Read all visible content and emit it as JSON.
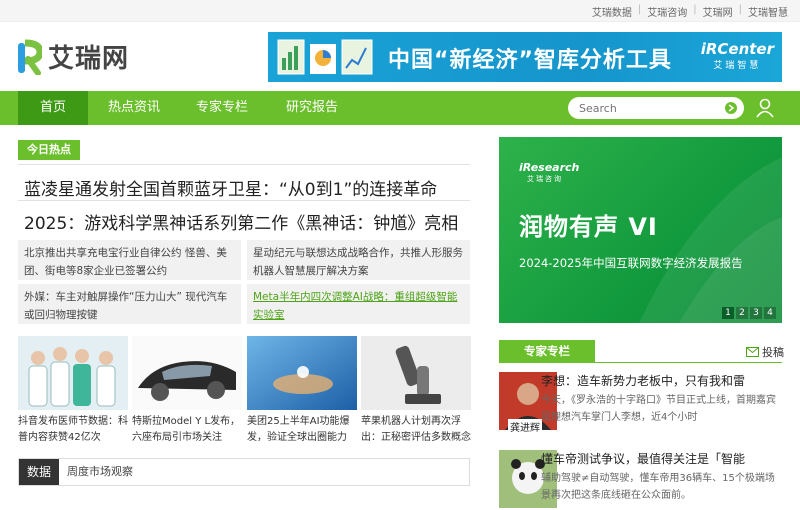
{
  "topbar": {
    "links": [
      "艾瑞数据",
      "艾瑞咨询",
      "艾瑞网",
      "艾瑞智慧"
    ]
  },
  "logo": {
    "text": "艾瑞网"
  },
  "banner": {
    "title": "中国“新经济”智库分析工具",
    "brand_main": "iRCenter",
    "brand_sub": "艾瑞智慧"
  },
  "nav": {
    "items": [
      "首页",
      "热点资讯",
      "专家专栏",
      "研究报告"
    ],
    "active": 0
  },
  "search": {
    "placeholder": "Search"
  },
  "today": {
    "tag": "今日热点",
    "headlines": [
      "蓝凌星通发射全国首颗蓝牙卫星：“从0到1”的连接革命",
      "2025：游戏科学黑神话系列第二作《黑神话：钟馗》亮相"
    ],
    "briefs": [
      "北京推出共享充电宝行业自律公约 怪兽、美团、街电等8家企业已签署公约",
      "星动纪元与联想达成战略合作，共推人形服务机器人智慧展厅解决方案",
      "外媒：车主对触屏操作“压力山大” 现代汽车或回归物理按键",
      "Meta半年内四次调整AI战略：重组超级智能实验室"
    ]
  },
  "thumbs": [
    "抖音发布医师节数据：科普内容获赞42亿次",
    "特斯拉Model Y L发布，六座布局引市场关注",
    "美团25上半年AI功能爆发，验证全球出圈能力",
    "苹果机器人计划再次浮出：正秘密评估多数概念"
  ],
  "data_tab": {
    "label": "数据",
    "sub": "周度市场观察"
  },
  "promo": {
    "brand_main": "iResearch",
    "brand_sub": "艾瑞咨询",
    "title": "润物有声 VI",
    "subtitle": "2024-2025年中国互联网数字经济发展报告",
    "pages": [
      "1",
      "2",
      "3",
      "4"
    ],
    "active_page": 0
  },
  "experts": {
    "tag": "专家专栏",
    "submit": "投稿",
    "items": [
      {
        "name": "龚进辉",
        "title": "李想：造车新势力老板中，只有我和雷",
        "desc": "今天，《罗永浩的十字路口》节目正式上线，首期嘉宾是理想汽车掌门人李想，近4个小时"
      },
      {
        "name": "",
        "title": "懂车帝测试争议，最值得关注是「智能",
        "desc": "辅助驾驶≠自动驾驶，懂车帝用36辆车、15个极端场景再次把这条底线砸在公众面前。"
      }
    ]
  },
  "colors": {
    "green": "#6cbf2c",
    "dark_green": "#3e9a14",
    "banner_blue": "#1595cc"
  }
}
